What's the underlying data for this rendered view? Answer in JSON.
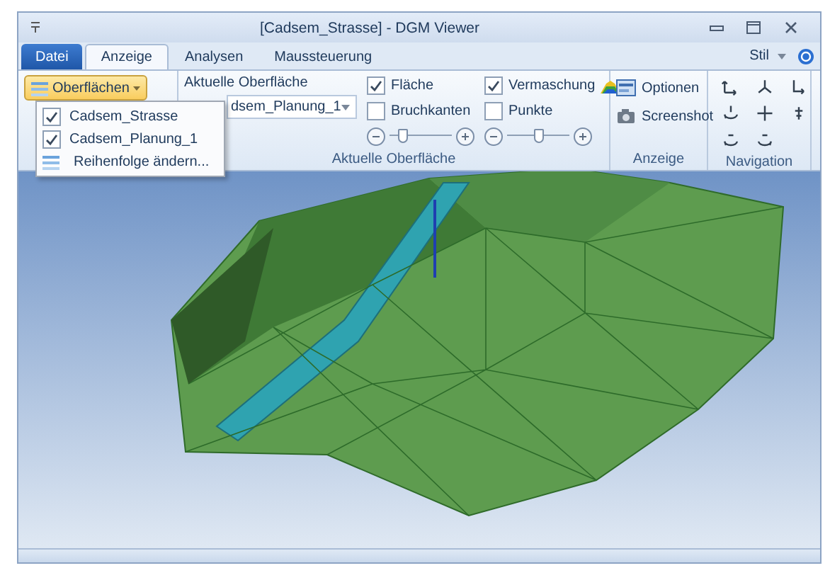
{
  "window": {
    "title": "[Cadsem_Strasse] - DGM Viewer"
  },
  "tabs": [
    {
      "label": "Datei",
      "kind": "file",
      "selected": false
    },
    {
      "label": "Anzeige",
      "kind": "tab",
      "selected": true
    },
    {
      "label": "Analysen",
      "kind": "tab",
      "selected": false
    },
    {
      "label": "Maussteuerung",
      "kind": "tab",
      "selected": false
    }
  ],
  "style_menu": {
    "label": "Stil"
  },
  "surfaces_button": {
    "label": "Oberflächen",
    "expanded": true
  },
  "current_surface": {
    "label": "Aktuelle Oberfläche",
    "value": "dsem_Planung_1"
  },
  "surface_group": {
    "title": "Aktuelle Oberfläche",
    "columns": [
      {
        "options": [
          {
            "label": "Fläche",
            "checked": true
          },
          {
            "label": "Bruchkanten",
            "checked": false
          }
        ],
        "level": 0.2
      },
      {
        "options": [
          {
            "label": "Vermaschung",
            "checked": true
          },
          {
            "label": "Punkte",
            "checked": false
          }
        ],
        "level": 0.5
      }
    ]
  },
  "display_group": {
    "title": "Anzeige",
    "buttons": [
      {
        "label": "Optionen",
        "kind": "options"
      },
      {
        "label": "Screenshot",
        "kind": "camera"
      }
    ]
  },
  "navigation_group": {
    "title": "Navigation"
  },
  "dropdown_menu": [
    {
      "label": "Cadsem_Strasse",
      "kind": "check",
      "checked": true
    },
    {
      "label": "Cadsem_Planung_1",
      "kind": "check",
      "checked": true
    },
    {
      "label": "Reihenfolge ändern...",
      "kind": "command"
    }
  ]
}
